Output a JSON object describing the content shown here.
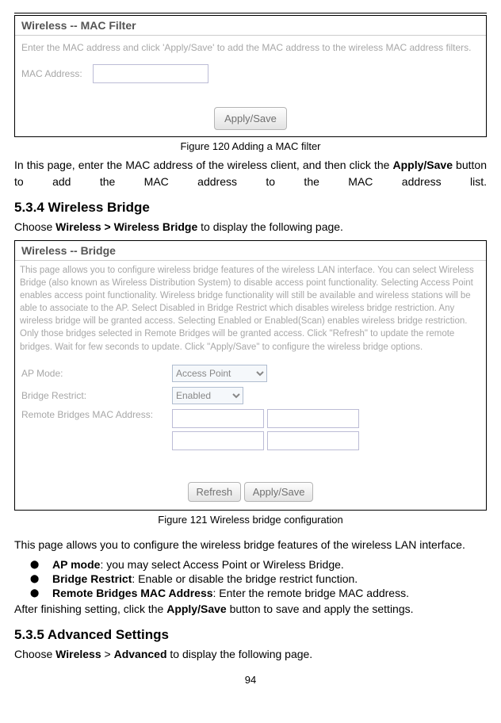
{
  "panel1": {
    "title": "Wireless -- MAC Filter",
    "instruction": "Enter the MAC address and click 'Apply/Save' to add the MAC address to the wireless MAC address filters.",
    "mac_label": "MAC Address:",
    "apply_save": "Apply/Save"
  },
  "caption1": "Figure 120 Adding a MAC filter",
  "para1a": "In this page, enter the MAC address of the wireless client, and then click the ",
  "para1b_bold": "Apply/Save",
  "para1c": " button to add the MAC address to the MAC address list.",
  "heading1": "5.3.4  Wireless Bridge",
  "choose1a": "Choose ",
  "choose1b_bold": "Wireless > Wireless Bridge",
  "choose1c": " to display the following page.",
  "panel2": {
    "title": "Wireless -- Bridge",
    "help": "This page allows you to configure wireless bridge features of the wireless LAN interface. You can select Wireless Bridge (also known as Wireless Distribution System) to disable access point functionality. Selecting Access Point enables access point functionality. Wireless bridge functionality will still be available and wireless stations will be able to associate to the AP. Select Disabled in Bridge Restrict which disables wireless bridge restriction. Any wireless bridge will be granted access. Selecting Enabled or Enabled(Scan) enables wireless bridge restriction. Only those bridges selected in Remote Bridges will be granted access. Click \"Refresh\" to update the remote bridges. Wait for few seconds to update. Click \"Apply/Save\" to configure the wireless bridge options.",
    "ap_mode_label": "AP Mode:",
    "ap_mode_value": "Access Point",
    "bridge_restrict_label": "Bridge Restrict:",
    "bridge_restrict_value": "Enabled",
    "remote_label": "Remote Bridges MAC Address:",
    "refresh": "Refresh",
    "apply_save": "Apply/Save"
  },
  "caption2": "Figure 121 Wireless bridge configuration",
  "para2": "This page allows you to configure the wireless bridge features of the wireless LAN interface.",
  "bullets": {
    "b1_bold": "AP mode",
    "b1_text": ": you may select Access Point or Wireless Bridge.",
    "b2_bold": "Bridge Restrict",
    "b2_text": ": Enable or disable the bridge restrict function.",
    "b3_bold": "Remote Bridges MAC Address",
    "b3_text": ": Enter the remote bridge MAC address."
  },
  "para3a": "After finishing setting, click the ",
  "para3b_bold": "Apply/Save",
  "para3c": " button to save and apply the settings.",
  "heading2": "5.3.5  Advanced Settings",
  "choose2a": "Choose ",
  "choose2b_bold": "Wireless",
  "choose2c": " > ",
  "choose2d_bold": "Advanced",
  "choose2e": " to display the following page.",
  "page_number": "94"
}
